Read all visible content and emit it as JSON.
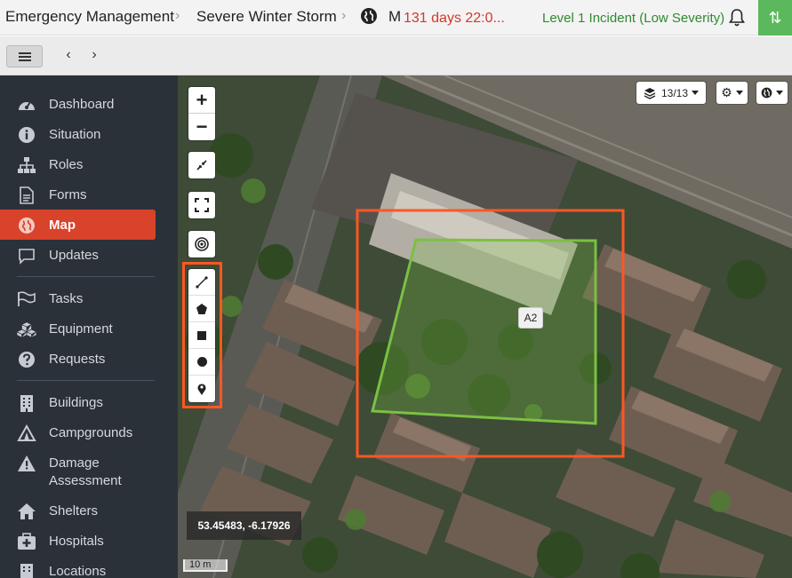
{
  "header": {
    "crumbs": [
      "Emergency Management",
      "Severe Winter Storm"
    ],
    "crumb_cut": "M",
    "timer": "131 days 22:0...",
    "incident_status": "Level 1 Incident (Low Severity)",
    "colors": {
      "timer": "#d2392b",
      "incident": "#2f8a2f",
      "action": "#5cb85c"
    },
    "icons": [
      "globe-icon",
      "bell-icon",
      "sort-arrows-icon"
    ]
  },
  "toolbar": {
    "icons": [
      "hamburger-menu-icon",
      "chevron-left-icon",
      "chevron-right-icon"
    ],
    "back": "‹",
    "forward": "›"
  },
  "sidebar": {
    "items": [
      {
        "label": "Dashboard",
        "icon": "dashboard-icon"
      },
      {
        "label": "Situation",
        "icon": "info-icon"
      },
      {
        "label": "Roles",
        "icon": "org-chart-icon"
      },
      {
        "label": "Forms",
        "icon": "document-icon"
      },
      {
        "label": "Map",
        "icon": "globe-icon",
        "active": true
      },
      {
        "label": "Updates",
        "icon": "chat-bubble-icon"
      },
      {
        "label": "Tasks",
        "icon": "flag-icon"
      },
      {
        "label": "Equipment",
        "icon": "boxes-icon"
      },
      {
        "label": "Requests",
        "icon": "question-icon"
      },
      {
        "label": "Buildings",
        "icon": "building-icon"
      },
      {
        "label": "Campgrounds",
        "icon": "tent-icon"
      },
      {
        "label": "Damage Assessment",
        "icon": "warning-icon"
      },
      {
        "label": "Shelters",
        "icon": "house-icon"
      },
      {
        "label": "Hospitals",
        "icon": "medical-icon"
      },
      {
        "label": "Locations",
        "icon": "building-icon"
      }
    ],
    "colors": {
      "background": "#2b3139",
      "active": "#d9432b"
    }
  },
  "map": {
    "zoom_in": "+",
    "zoom_out": "−",
    "layers_count": "13/13",
    "coordinates": "53.45483, -6.17926",
    "scale_label": "10 m",
    "area_label": "A2",
    "draw_tools": [
      "line-draw-icon",
      "polygon-draw-icon",
      "square-draw-icon",
      "circle-draw-icon",
      "marker-draw-icon"
    ],
    "colors": {
      "highlight": "#ff5722",
      "area": "#7bc043"
    }
  }
}
